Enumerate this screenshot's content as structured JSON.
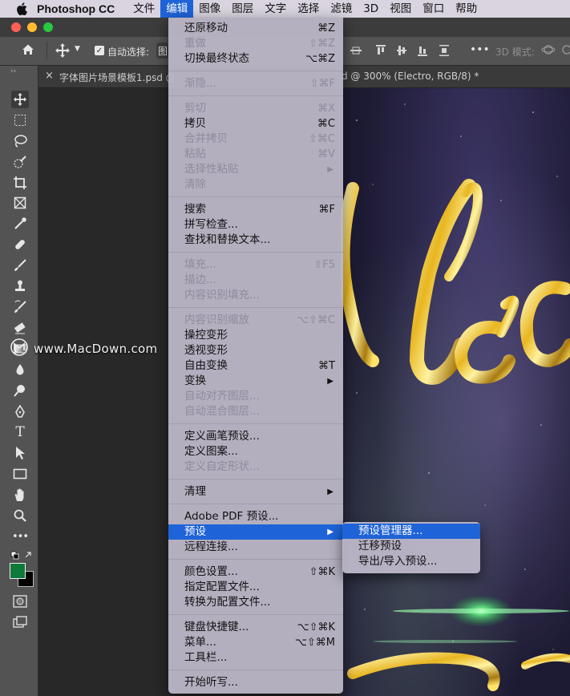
{
  "menubar": {
    "app_name": "Photoshop CC",
    "items": [
      "文件",
      "编辑",
      "图像",
      "图层",
      "文字",
      "选择",
      "滤镜",
      "3D",
      "视图",
      "窗口",
      "帮助"
    ],
    "active_index": 1
  },
  "optionsbar": {
    "auto_select_label": "自动选择:",
    "auto_select_value": "图",
    "mode_3d_label": "3D 模式:"
  },
  "tabs": {
    "tab1": "字体图片场景模板1.psd @",
    "tab2_partial": "d @ 300% (Electro, RGB/8) *",
    "close_glyph": "×"
  },
  "watermark": {
    "text": "www.MacDown.com"
  },
  "edit_menu": {
    "groups": [
      [
        {
          "label": "还原移动",
          "shortcut": "⌘Z",
          "enabled": true
        },
        {
          "label": "重做",
          "shortcut": "⇧⌘Z",
          "enabled": false
        },
        {
          "label": "切换最终状态",
          "shortcut": "⌥⌘Z",
          "enabled": true
        }
      ],
      [
        {
          "label": "渐隐...",
          "shortcut": "⇧⌘F",
          "enabled": false
        }
      ],
      [
        {
          "label": "剪切",
          "shortcut": "⌘X",
          "enabled": false
        },
        {
          "label": "拷贝",
          "shortcut": "⌘C",
          "enabled": true
        },
        {
          "label": "合并拷贝",
          "shortcut": "⇧⌘C",
          "enabled": false
        },
        {
          "label": "粘贴",
          "shortcut": "⌘V",
          "enabled": false
        },
        {
          "label": "选择性粘贴",
          "shortcut": "",
          "enabled": false,
          "submenu": true
        },
        {
          "label": "清除",
          "shortcut": "",
          "enabled": false
        }
      ],
      [
        {
          "label": "搜索",
          "shortcut": "⌘F",
          "enabled": true
        },
        {
          "label": "拼写检查...",
          "shortcut": "",
          "enabled": true
        },
        {
          "label": "查找和替换文本...",
          "shortcut": "",
          "enabled": true
        }
      ],
      [
        {
          "label": "填充...",
          "shortcut": "⇧F5",
          "enabled": false
        },
        {
          "label": "描边...",
          "shortcut": "",
          "enabled": false
        },
        {
          "label": "内容识别填充...",
          "shortcut": "",
          "enabled": false
        }
      ],
      [
        {
          "label": "内容识别缩放",
          "shortcut": "⌥⇧⌘C",
          "enabled": false
        },
        {
          "label": "操控变形",
          "shortcut": "",
          "enabled": true
        },
        {
          "label": "透视变形",
          "shortcut": "",
          "enabled": true
        },
        {
          "label": "自由变换",
          "shortcut": "⌘T",
          "enabled": true
        },
        {
          "label": "变换",
          "shortcut": "",
          "enabled": true,
          "submenu": true
        },
        {
          "label": "自动对齐图层...",
          "shortcut": "",
          "enabled": false
        },
        {
          "label": "自动混合图层...",
          "shortcut": "",
          "enabled": false
        }
      ],
      [
        {
          "label": "定义画笔预设...",
          "shortcut": "",
          "enabled": true
        },
        {
          "label": "定义图案...",
          "shortcut": "",
          "enabled": true
        },
        {
          "label": "定义自定形状...",
          "shortcut": "",
          "enabled": false
        }
      ],
      [
        {
          "label": "清理",
          "shortcut": "",
          "enabled": true,
          "submenu": true
        }
      ],
      [
        {
          "label": "Adobe PDF 预设...",
          "shortcut": "",
          "enabled": true
        },
        {
          "label": "预设",
          "shortcut": "",
          "enabled": true,
          "submenu": true,
          "highlighted": true
        },
        {
          "label": "远程连接...",
          "shortcut": "",
          "enabled": true
        }
      ],
      [
        {
          "label": "颜色设置...",
          "shortcut": "⇧⌘K",
          "enabled": true
        },
        {
          "label": "指定配置文件...",
          "shortcut": "",
          "enabled": true
        },
        {
          "label": "转换为配置文件...",
          "shortcut": "",
          "enabled": true
        }
      ],
      [
        {
          "label": "键盘快捷键...",
          "shortcut": "⌥⇧⌘K",
          "enabled": true
        },
        {
          "label": "菜单...",
          "shortcut": "⌥⇧⌘M",
          "enabled": true
        },
        {
          "label": "工具栏...",
          "shortcut": "",
          "enabled": true
        }
      ],
      [
        {
          "label": "开始听写...",
          "shortcut": "",
          "enabled": true
        }
      ]
    ]
  },
  "presets_submenu": [
    {
      "label": "预设管理器...",
      "highlighted": true
    },
    {
      "label": "迁移预设",
      "highlighted": false
    },
    {
      "label": "导出/导入预设...",
      "highlighted": false
    }
  ],
  "colors": {
    "highlight": "#1f63d8",
    "foreground_swatch": "#0d7a3a",
    "background_swatch": "#000000"
  }
}
